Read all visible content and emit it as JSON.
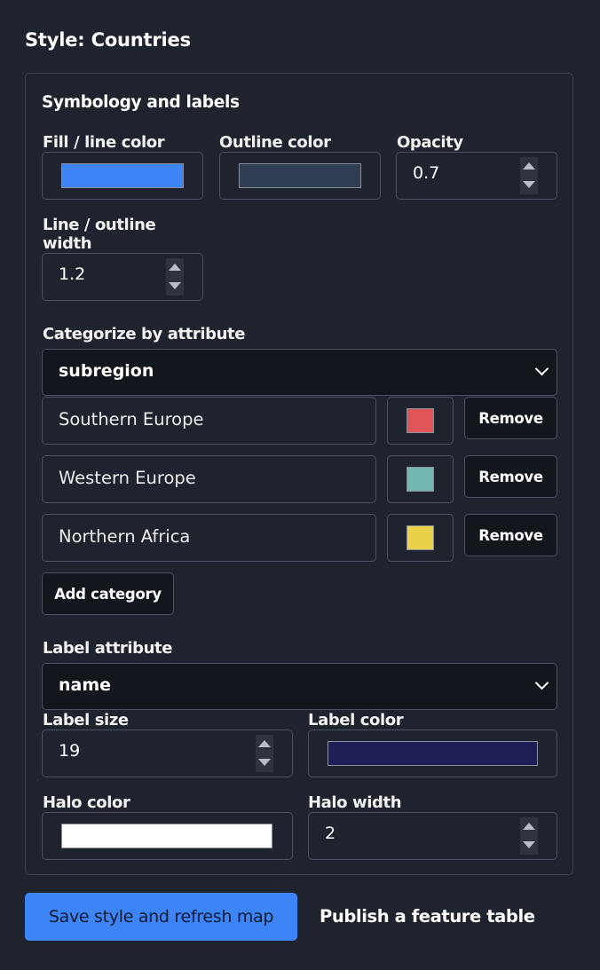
{
  "header": {
    "title": "Style: Countries"
  },
  "symbology": {
    "section_title": "Symbology and labels",
    "fill_color": {
      "label": "Fill / line color",
      "value": "#3d84f6"
    },
    "outline_color": {
      "label": "Outline color",
      "value": "#2f3e52"
    },
    "opacity": {
      "label": "Opacity",
      "value": "0.7"
    },
    "line_width": {
      "label": "Line / outline width",
      "value": "1.2"
    }
  },
  "categorize": {
    "label": "Categorize by attribute",
    "selected": "subregion",
    "categories": [
      {
        "name": "Southern Europe",
        "color": "#e05558",
        "remove_label": "Remove"
      },
      {
        "name": "Western Europe",
        "color": "#73b8b2",
        "remove_label": "Remove"
      },
      {
        "name": "Northern Africa",
        "color": "#ead14c",
        "remove_label": "Remove"
      }
    ],
    "add_label": "Add category"
  },
  "labels": {
    "attribute_label": "Label attribute",
    "attribute_selected": "name",
    "size": {
      "label": "Label size",
      "value": "19"
    },
    "color": {
      "label": "Label color",
      "value": "#1e1f57"
    },
    "halo_color": {
      "label": "Halo color",
      "value": "#ffffff"
    },
    "halo_width": {
      "label": "Halo width",
      "value": "2"
    }
  },
  "actions": {
    "save_label": "Save style and refresh map",
    "publish_label": "Publish a feature table"
  }
}
